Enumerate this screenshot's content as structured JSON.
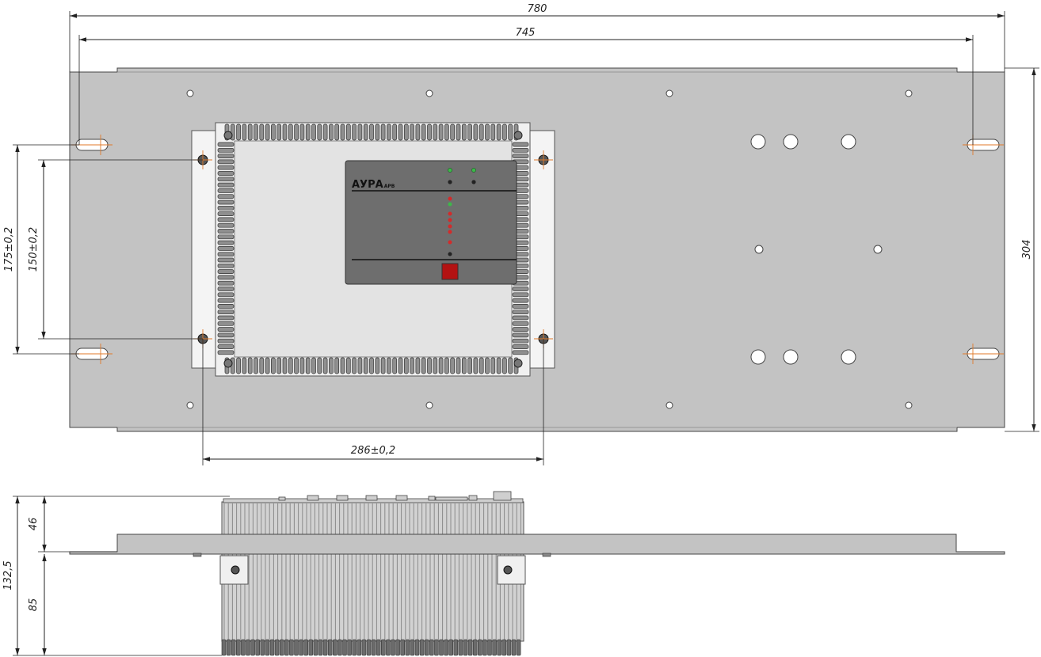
{
  "dimensions": {
    "overall_width": "780",
    "slot_spacing": "745",
    "panel_height": "304",
    "slot_vertical": "175±0,2",
    "hole_vertical": "150±0,2",
    "hole_horizontal": "286±0,2",
    "top_height": "46",
    "total_depth": "132,5",
    "bottom_depth": "85"
  },
  "device": {
    "brand": "АУРА",
    "brand_suffix": "АРВ"
  },
  "colors": {
    "panel": "#c3c3c3",
    "device_face": "#6e6e6e",
    "heatsink": "#8f8f8f",
    "led_green": "#3db84a",
    "led_red": "#d42a2a",
    "button": "#b31212",
    "dimension_line": "#222222",
    "center_mark": "#e07a2a"
  }
}
